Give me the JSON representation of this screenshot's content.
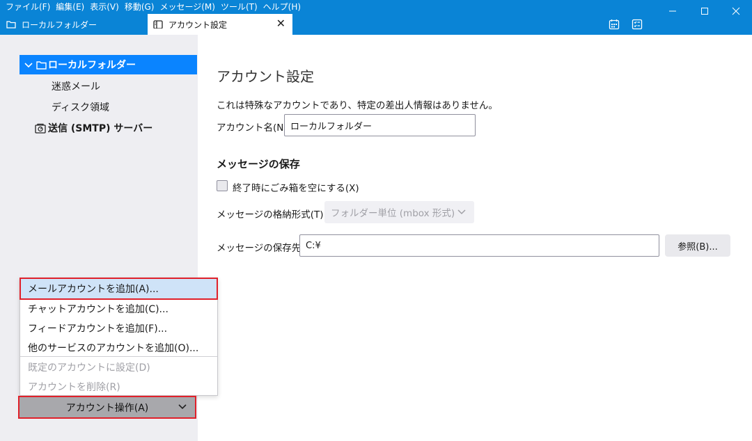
{
  "menubar": {
    "items": [
      "ファイル(F)",
      "編集(E)",
      "表示(V)",
      "移動(G)",
      "メッセージ(M)",
      "ツール(T)",
      "ヘルプ(H)"
    ]
  },
  "tabs": {
    "inactive_label": "ローカルフォルダー",
    "active_label": "アカウント設定"
  },
  "tree": {
    "root_label": "ローカルフォルダー",
    "children": [
      "迷惑メール",
      "ディスク領域"
    ],
    "smtp_label": "送信 (SMTP) サーバー"
  },
  "settings": {
    "title": "アカウント設定",
    "description": "これは特殊なアカウントであり、特定の差出人情報はありません。",
    "account_name_label": "アカウント名(N):",
    "account_name_value": "ローカルフォルダー",
    "storage_heading": "メッセージの保存",
    "empty_trash_label": "終了時にごみ箱を空にする(X)",
    "store_format_label": "メッセージの格納形式(T):",
    "store_format_value": "フォルダー単位 (mbox 形式)",
    "store_path_label": "メッセージの保存先:",
    "store_path_value": "C:¥",
    "browse_label": "参照(B)..."
  },
  "popup_menu": {
    "items": [
      {
        "label": "メールアカウントを追加(A)...",
        "enabled": true,
        "highlighted": true
      },
      {
        "label": "チャットアカウントを追加(C)...",
        "enabled": true
      },
      {
        "label": "フィードアカウントを追加(F)...",
        "enabled": true
      },
      {
        "label": "他のサービスのアカウントを追加(O)...",
        "enabled": true
      },
      {
        "label": "既定のアカウントに設定(D)",
        "enabled": false
      },
      {
        "label": "アカウントを削除(R)",
        "enabled": false
      }
    ]
  },
  "account_actions_label": "アカウント操作(A)",
  "colors": {
    "titlebar": "#0a84d6",
    "selection": "#0a84ff",
    "highlight_border": "#e0202a",
    "left_pane_bg": "#eeeef2"
  }
}
